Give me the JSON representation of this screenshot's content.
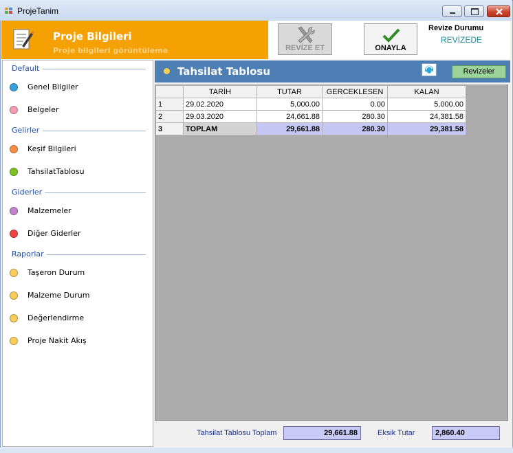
{
  "window": {
    "title": "ProjeTanim"
  },
  "header": {
    "title": "Proje Bilgileri",
    "subtitle": "Proje bilgileri görüntüleme",
    "revize_button": "REVİZE ET",
    "onayla_button": "ONAYLA",
    "revize_durumu_title": "Revize Durumu",
    "revize_durumu_value": "REVİZEDE"
  },
  "sidebar": {
    "groups": [
      {
        "label": "Default",
        "items": [
          {
            "label": "Genel Bilgiler",
            "color": "#3aa0d9"
          },
          {
            "label": "Belgeler",
            "color": "#f49db0"
          }
        ]
      },
      {
        "label": "Gelirler",
        "items": [
          {
            "label": "Keşif Bilgileri",
            "color": "#f68f45"
          },
          {
            "label": "TahsilatTablosu",
            "color": "#7cc222"
          }
        ]
      },
      {
        "label": "Giderler",
        "items": [
          {
            "label": "Malzemeler",
            "color": "#c082c8"
          },
          {
            "label": "Diğer Giderler",
            "color": "#ee4444"
          }
        ]
      },
      {
        "label": "Raporlar",
        "items": [
          {
            "label": "Taşeron Durum",
            "color": "#f8cd5c"
          },
          {
            "label": "Malzeme Durum",
            "color": "#f8cd5c"
          },
          {
            "label": "Değerlendirme",
            "color": "#f8cd5c"
          },
          {
            "label": "Proje Nakit Akış",
            "color": "#f8cd5c"
          }
        ]
      }
    ]
  },
  "section": {
    "title": "Tahsilat Tablosu",
    "revizeler_button": "Revizeler"
  },
  "table": {
    "columns": [
      "TARİH",
      "TUTAR",
      "GERCEKLESEN",
      "KALAN"
    ],
    "rows": [
      {
        "n": "1",
        "tarih": "29.02.2020",
        "tutar": "5,000.00",
        "gerceklesen": "0.00",
        "kalan": "5,000.00"
      },
      {
        "n": "2",
        "tarih": "29.03.2020",
        "tutar": "24,661.88",
        "gerceklesen": "280.30",
        "kalan": "24,381.58"
      },
      {
        "n": "3",
        "tarih": "TOPLAM",
        "tutar": "29,661.88",
        "gerceklesen": "280.30",
        "kalan": "29,381.58"
      }
    ]
  },
  "footer": {
    "total_label": "Tahsilat Tablosu Toplam",
    "total_value": "29,661.88",
    "missing_label": "Eksik Tutar",
    "missing_value": "2,860.40"
  }
}
